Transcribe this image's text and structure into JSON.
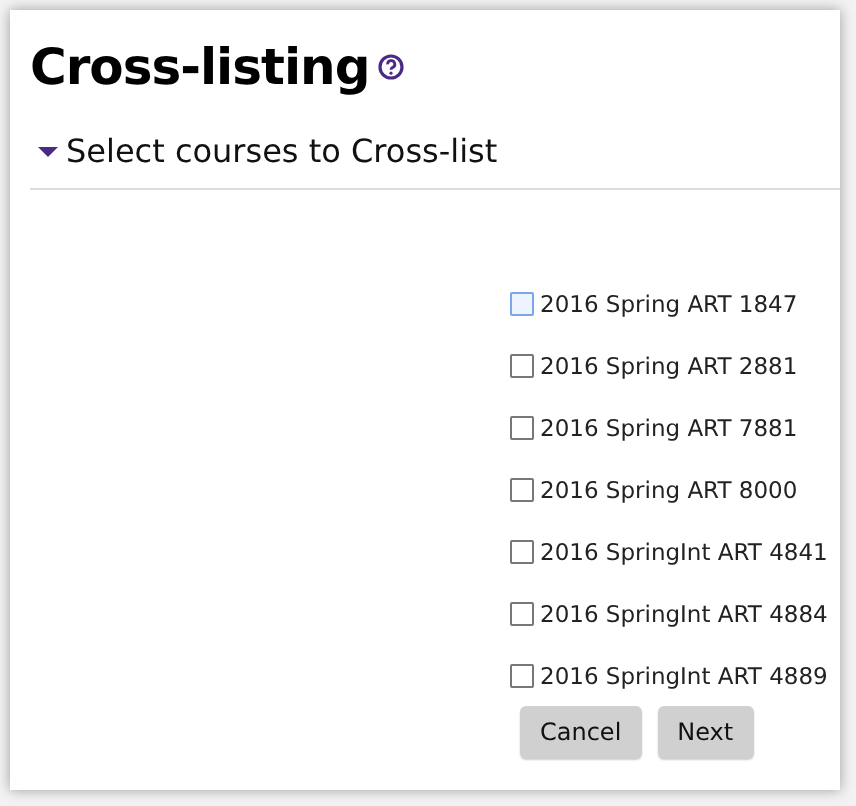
{
  "title": "Cross-listing",
  "section": {
    "label": "Select courses to Cross-list",
    "expanded": true
  },
  "courses": [
    {
      "label": "2016 Spring ART 1847",
      "checked": false,
      "hovered": true
    },
    {
      "label": "2016 Spring ART 2881",
      "checked": false,
      "hovered": false
    },
    {
      "label": "2016 Spring ART 7881",
      "checked": false,
      "hovered": false
    },
    {
      "label": "2016 Spring ART 8000",
      "checked": false,
      "hovered": false
    },
    {
      "label": "2016 SpringInt ART 4841",
      "checked": false,
      "hovered": false
    },
    {
      "label": "2016 SpringInt ART 4884",
      "checked": false,
      "hovered": false
    },
    {
      "label": "2016 SpringInt ART 4889",
      "checked": false,
      "hovered": false
    }
  ],
  "buttons": [
    "Cancel",
    "Next"
  ]
}
